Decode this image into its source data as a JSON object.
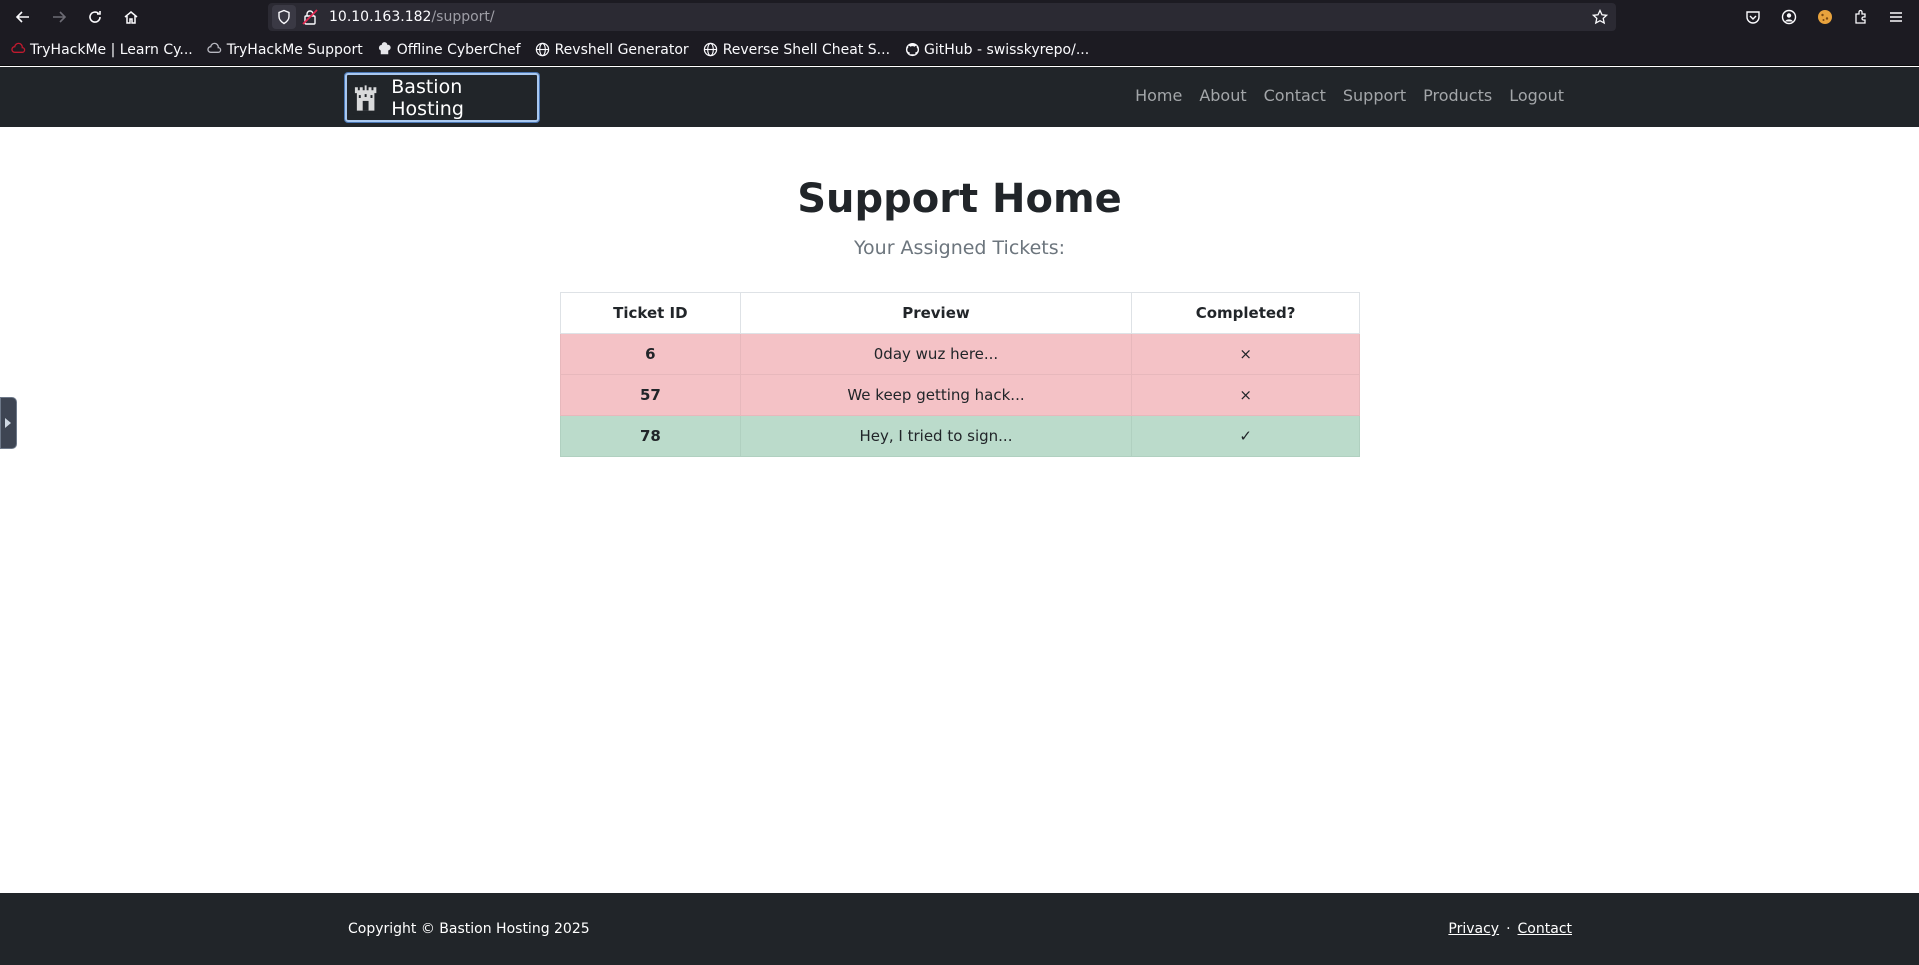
{
  "browser": {
    "url_host": "10.10.163.182",
    "url_path": "/support/",
    "bookmarks": [
      {
        "label": "TryHackMe | Learn Cy...",
        "icon": "tryhackme-icon"
      },
      {
        "label": "TryHackMe Support",
        "icon": "cloud-icon"
      },
      {
        "label": "Offline CyberChef",
        "icon": "chef-hat-icon"
      },
      {
        "label": "Revshell Generator",
        "icon": "globe-icon"
      },
      {
        "label": "Reverse Shell Cheat S...",
        "icon": "globe-icon"
      },
      {
        "label": "GitHub - swisskyrepo/...",
        "icon": "github-icon"
      }
    ]
  },
  "site": {
    "brand": "Bastion Hosting",
    "nav": [
      "Home",
      "About",
      "Contact",
      "Support",
      "Products",
      "Logout"
    ]
  },
  "main": {
    "title": "Support Home",
    "subtitle": "Your Assigned Tickets:",
    "table": {
      "headers": [
        "Ticket ID",
        "Preview",
        "Completed?"
      ],
      "rows": [
        {
          "id": "6",
          "preview": "0day wuz here...",
          "completed": "×",
          "status_color": "#f4c2c6"
        },
        {
          "id": "57",
          "preview": "We keep getting hack...",
          "completed": "×",
          "status_color": "#f4c2c6"
        },
        {
          "id": "78",
          "preview": "Hey, I tried to sign...",
          "completed": "✓",
          "status_color": "#bbdbcb"
        }
      ]
    }
  },
  "footer": {
    "copyright": "Copyright © Bastion Hosting 2025",
    "links": [
      "Privacy",
      "Contact"
    ],
    "separator": "·"
  }
}
